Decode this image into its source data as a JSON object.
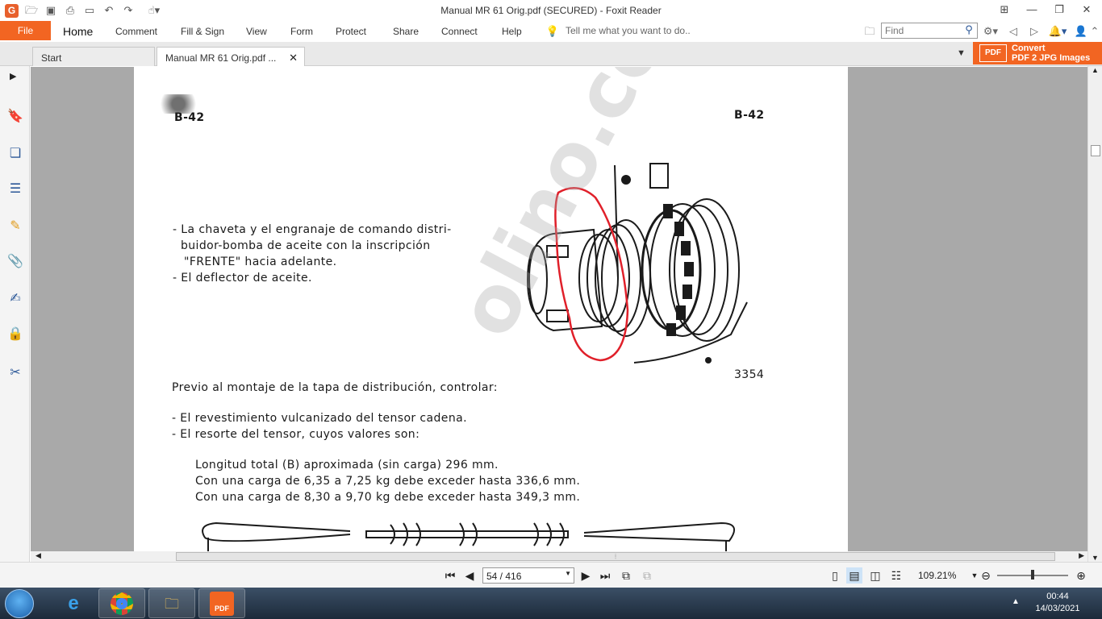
{
  "window": {
    "title": "Manual MR 61 Orig.pdf (SECURED) - Foxit Reader"
  },
  "ribbon": {
    "file": "File",
    "tabs": [
      "Home",
      "Comment",
      "Fill & Sign",
      "View",
      "Form",
      "Protect",
      "Share",
      "Connect",
      "Help"
    ],
    "tell_me": "Tell me what you want to do..",
    "find_placeholder": "Find"
  },
  "doc_tabs": {
    "start": "Start",
    "active": "Manual MR 61 Orig.pdf ..."
  },
  "promo": {
    "icon_label": "PDF",
    "line1": "Convert",
    "line2": "PDF 2 JPG Images"
  },
  "page": {
    "page_code_left": "B-42",
    "page_code_right": "B-42",
    "figure_number": "3354",
    "watermark": "olino.com.ar",
    "list1": [
      "- La chaveta y el engranaje de comando distri-",
      "buidor-bomba de aceite con la inscripción",
      "\"FRENTE\" hacia adelante.",
      "- El deflector de aceite."
    ],
    "heading": "Previo al montaje de la tapa de distribución, controlar:",
    "list2": [
      "- El revestimiento vulcanizado del tensor cadena.",
      "- El resorte del tensor, cuyos valores son:"
    ],
    "specs": [
      "Longitud total (B) aproximada (sin carga) 296 mm.",
      "Con una carga de 6,35 a 7,25 kg debe exceder hasta 336,6 mm.",
      "Con una carga de 8,30 a 9,70 kg debe exceder hasta 349,3 mm."
    ]
  },
  "status": {
    "page_indicator": "54 / 416",
    "zoom": "109.21%"
  },
  "taskbar": {
    "time": "00:44",
    "date": "14/03/2021",
    "foxit_label": "PDF"
  }
}
